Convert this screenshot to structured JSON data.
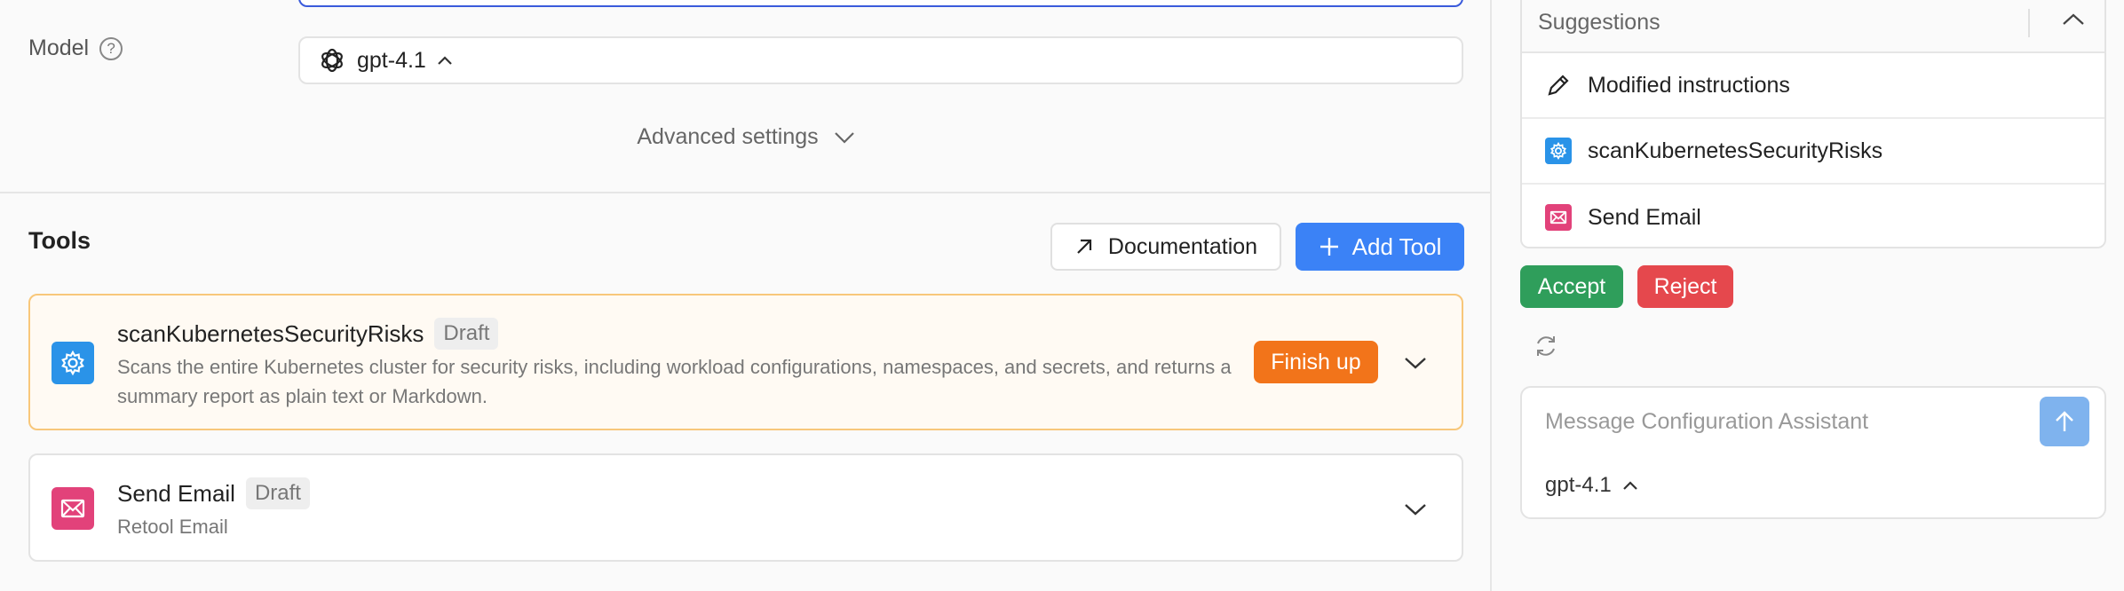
{
  "model": {
    "label": "Model",
    "help": "?",
    "selected": "gpt-4.1"
  },
  "advanced_settings": "Advanced settings",
  "tools": {
    "title": "Tools",
    "documentation_label": "Documentation",
    "add_tool_label": "Add Tool",
    "items": [
      {
        "name": "scanKubernetesSecurityRisks",
        "badge": "Draft",
        "description": "Scans the entire Kubernetes cluster for security risks, including workload configurations, namespaces, and secrets, and returns a summary report as plain text or Markdown.",
        "action_label": "Finish up",
        "icon": "gear-icon"
      },
      {
        "name": "Send Email",
        "badge": "Draft",
        "description": "Retool Email",
        "icon": "mail-icon"
      }
    ]
  },
  "suggestions": {
    "title": "Suggestions",
    "items": [
      {
        "label": "Modified instructions",
        "icon": "pencil-icon"
      },
      {
        "label": "scanKubernetesSecurityRisks",
        "icon": "gear-icon"
      },
      {
        "label": "Send Email",
        "icon": "mail-icon"
      }
    ],
    "accept_label": "Accept",
    "reject_label": "Reject"
  },
  "assistant": {
    "placeholder": "Message Configuration Assistant",
    "model": "gpt-4.1"
  },
  "colors": {
    "primary": "#3b82f6",
    "finish": "#f2741a",
    "accept": "#2f9e5b",
    "reject": "#e5484d",
    "tool_blue": "#2a93e8",
    "tool_pink": "#e2427a"
  }
}
